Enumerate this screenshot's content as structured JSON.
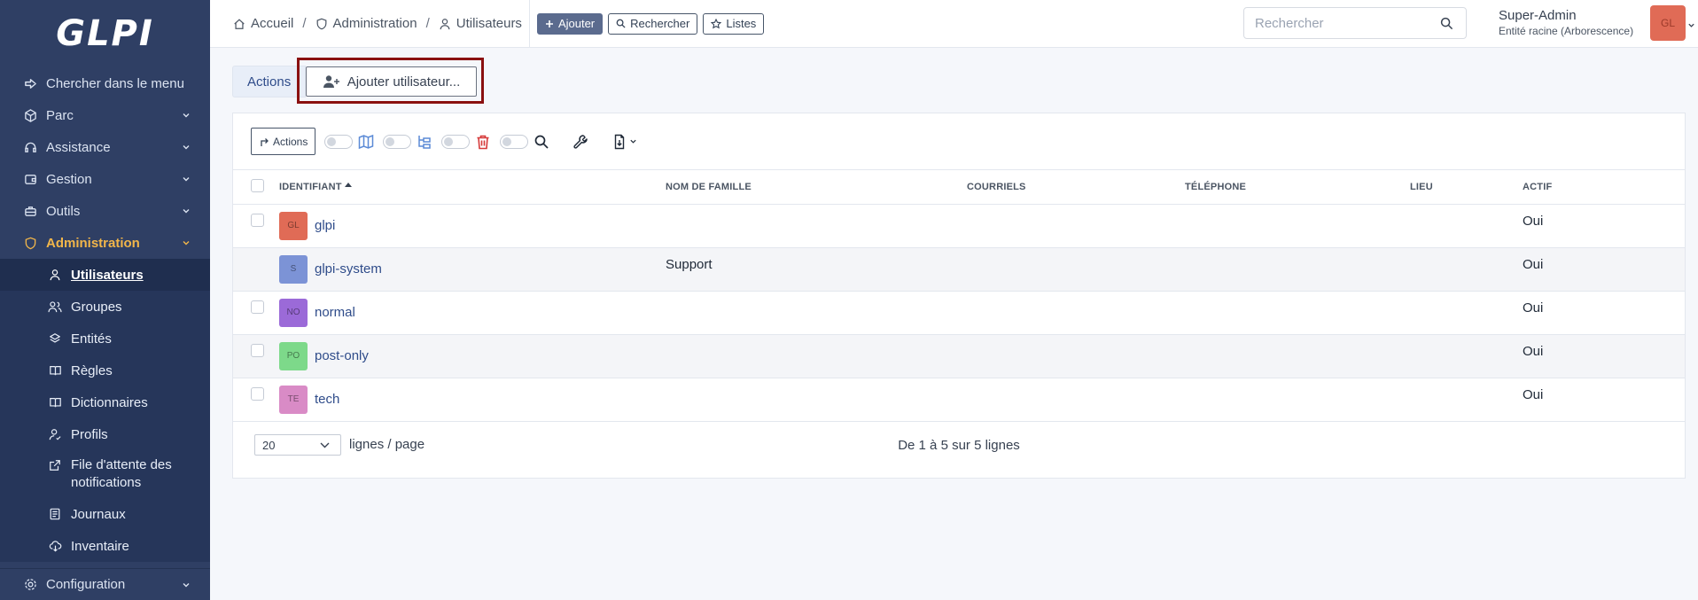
{
  "sidebar": {
    "logo": "GLPI",
    "search_menu": "Chercher dans le menu",
    "items": [
      {
        "label": "Parc"
      },
      {
        "label": "Assistance"
      },
      {
        "label": "Gestion"
      },
      {
        "label": "Outils"
      },
      {
        "label": "Administration"
      }
    ],
    "admin_sub": [
      {
        "label": "Utilisateurs"
      },
      {
        "label": "Groupes"
      },
      {
        "label": "Entités"
      },
      {
        "label": "Règles"
      },
      {
        "label": "Dictionnaires"
      },
      {
        "label": "Profils"
      },
      {
        "label": "File d'attente des notifications"
      },
      {
        "label": "Journaux"
      },
      {
        "label": "Inventaire"
      }
    ],
    "config": "Configuration"
  },
  "header": {
    "breadcrumb": [
      "Accueil",
      "Administration",
      "Utilisateurs"
    ],
    "sep": "/",
    "add_label": "Ajouter",
    "search_label": "Rechercher",
    "lists_label": "Listes",
    "search_placeholder": "Rechercher",
    "user_name": "Super-Admin",
    "user_entity": "Entité racine (Arborescence)",
    "user_initials": "GL"
  },
  "tabs": {
    "actions": "Actions",
    "add_user": "Ajouter utilisateur..."
  },
  "toolbar": {
    "actions": "Actions"
  },
  "table": {
    "columns": [
      "Identifiant",
      "Nom de famille",
      "Courriels",
      "Téléphone",
      "Lieu",
      "Actif"
    ],
    "rows": [
      {
        "initials": "GL",
        "color": "#e06b56",
        "ident": "glpi",
        "last_name": "",
        "active": "Oui"
      },
      {
        "initials": "S",
        "color": "#7c93d6",
        "ident": "glpi-system",
        "last_name": "Support",
        "active": "Oui"
      },
      {
        "initials": "NO",
        "color": "#9b6ad8",
        "ident": "normal",
        "last_name": "",
        "active": "Oui"
      },
      {
        "initials": "PO",
        "color": "#7dd98a",
        "ident": "post-only",
        "last_name": "",
        "active": "Oui"
      },
      {
        "initials": "TE",
        "color": "#d98bc6",
        "ident": "tech",
        "last_name": "",
        "active": "Oui"
      }
    ]
  },
  "footer": {
    "per_page": "20",
    "per_page_label": "lignes / page",
    "count": "De 1 à 5 sur 5 lignes"
  },
  "colors": {
    "sidebar": "#2f3f64",
    "active_menu": "#f2b64a",
    "link": "#2f4c8a",
    "highlight": "#8a1010"
  }
}
